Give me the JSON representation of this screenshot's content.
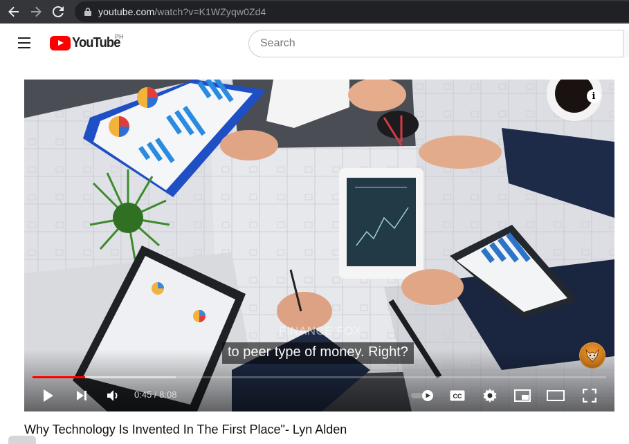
{
  "browser": {
    "url_host": "youtube.com",
    "url_path": "/watch?v=K1WZyqw0Zd4"
  },
  "header": {
    "logo_text": "YouTube",
    "region": "PH",
    "search_placeholder": "Search"
  },
  "player": {
    "watermark": "FINANCE FOX",
    "caption": "to peer type of money. Right?",
    "current_time": "0:45",
    "duration": "8:08",
    "time_display": "0:45 / 8:08",
    "played_fraction": 0.092,
    "buffered_fraction": 0.25,
    "info_glyph": "i",
    "cc_label": "CC"
  },
  "video": {
    "title": "Why Technology Is Invented In The First Place\"- Lyn Alden"
  },
  "colors": {
    "browser_bar": "#35363a",
    "omnibox": "#202124",
    "brand_red": "#ff0000",
    "progress_played": "#ff0000"
  },
  "icons": [
    "back-icon",
    "forward-icon",
    "reload-icon",
    "lock-icon",
    "hamburger-icon",
    "youtube-logo",
    "info-icon",
    "play-icon",
    "next-icon",
    "volume-icon",
    "autoplay-toggle",
    "captions-icon",
    "settings-icon",
    "miniplayer-icon",
    "theater-icon",
    "fullscreen-icon",
    "channel-avatar"
  ]
}
